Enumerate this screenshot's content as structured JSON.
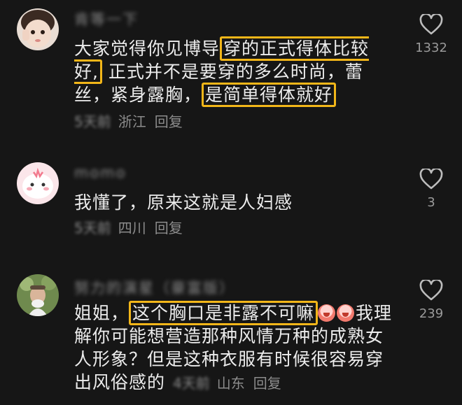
{
  "comments": [
    {
      "username": "肯等一下",
      "text_before": "大家觉得你见博导",
      "highlight_1": "穿的正式得体比较好,",
      "text_middle": "正式并不是要穿的多么时尚，蕾丝，紧身露胸，",
      "highlight_2": "是简单得体就好",
      "time": "5天前",
      "location": "浙江",
      "reply_label": "回复",
      "like_count": "1332"
    },
    {
      "username": "momo",
      "text": "我懂了，原来这就是人妇感",
      "time": "5天前",
      "location": "四川",
      "reply_label": "回复",
      "like_count": "3"
    },
    {
      "username": "努力的演星（豪富版）",
      "text_before": "姐姐，",
      "highlight_1": "这个胸口是非露不可嘛",
      "text_after": "我理解你可能想营造那种风情万种的成熟女人形象？但是这种衣服有时候很容易穿出风俗感的",
      "time": "4天前",
      "location": "山东",
      "reply_label": "回复",
      "like_count": "239"
    }
  ],
  "colors": {
    "background": "#161616",
    "highlight_border": "#f2b619",
    "meta_text": "#8c8c8c"
  },
  "icons": {
    "like": "heart-outline-icon",
    "emoji": "crying-face-emoji-icon"
  }
}
